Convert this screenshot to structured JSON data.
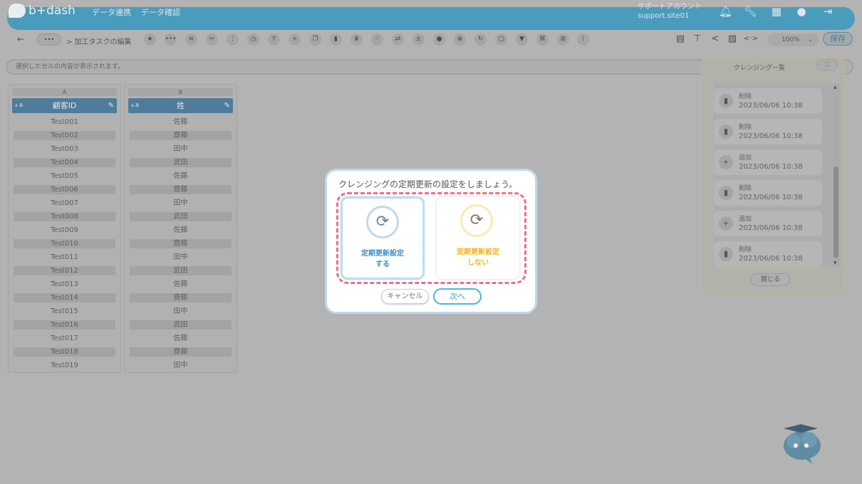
{
  "app": {
    "logo_text": "b+dash",
    "nav": [
      "データ連携",
      "データ確認"
    ],
    "account_label": "サポートアカウント",
    "account_id": "support.site01"
  },
  "header_icons": [
    "bell-icon",
    "wrench-icon",
    "grid-icon",
    "chat-icon",
    "logout-icon"
  ],
  "toolbar": {
    "back_label": "←",
    "more_label": "•••",
    "breadcrumb": "> 加工タスクの編集",
    "zoom": "100%",
    "save_label": "保存"
  },
  "cellbar": {
    "placeholder": "選択したセルの内容が表示されます。"
  },
  "columns": [
    {
      "letter": "A",
      "header": "顧客ID",
      "type_badge": "a あ",
      "cells": [
        "Test001",
        "Test002",
        "Test003",
        "Test004",
        "Test005",
        "Test006",
        "Test007",
        "Test008",
        "Test009",
        "Test010",
        "Test011",
        "Test012",
        "Test013",
        "Test014",
        "Test015",
        "Test016",
        "Test017",
        "Test018",
        "Test019"
      ]
    },
    {
      "letter": "B",
      "header": "姓",
      "type_badge": "a あ",
      "cells": [
        "佐藤",
        "齋藤",
        "田中",
        "武田",
        "佐藤",
        "齋藤",
        "田中",
        "武田",
        "佐藤",
        "齋藤",
        "田中",
        "武田",
        "佐藤",
        "齋藤",
        "田中",
        "武田",
        "佐藤",
        "齋藤",
        "田中"
      ]
    }
  ],
  "cleansing_panel": {
    "title": "クレンジング一覧",
    "expand_icon": "expand-icon",
    "items": [
      {
        "action": "削除",
        "timestamp": "2023/06/06 10:38",
        "icon": "trash-icon"
      },
      {
        "action": "削除",
        "timestamp": "2023/06/06 10:38",
        "icon": "trash-icon"
      },
      {
        "action": "追加",
        "timestamp": "2023/06/06 10:38",
        "icon": "plus-icon"
      },
      {
        "action": "削除",
        "timestamp": "2023/06/06 10:38",
        "icon": "trash-icon"
      },
      {
        "action": "追加",
        "timestamp": "2023/06/06 10:38",
        "icon": "plus-icon"
      },
      {
        "action": "削除",
        "timestamp": "2023/06/06 10:38",
        "icon": "trash-icon"
      }
    ],
    "close_label": "閉じる"
  },
  "modal": {
    "title": "クレンジングの定期更新の設定をしましょう。",
    "option_yes": {
      "line1": "定期更新設定",
      "line2": "する"
    },
    "option_no": {
      "line1": "定期更新設定",
      "line2": "しない"
    },
    "cancel_label": "キャンセル",
    "next_label": "次へ",
    "colors": {
      "accent_blue": "#3a92c9",
      "accent_yellow": "#f0b323",
      "highlight_dash": "#ec6f86"
    }
  }
}
